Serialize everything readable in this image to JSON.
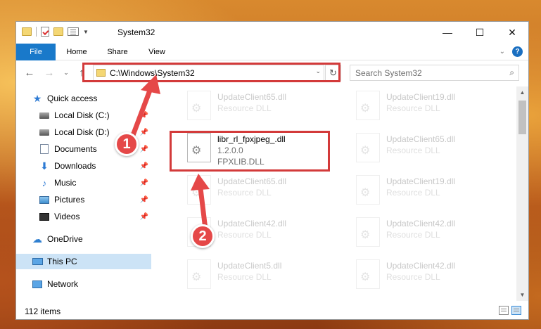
{
  "window": {
    "title": "System32",
    "controls": {
      "minimize": "—",
      "maximize": "☐",
      "close": "✕"
    }
  },
  "ribbon": {
    "tabs": [
      "File",
      "Home",
      "Share",
      "View"
    ],
    "expand_glyph": "⌄",
    "help_glyph": "?"
  },
  "nav": {
    "back_glyph": "←",
    "forward_glyph": "→",
    "recent_glyph": "⌄",
    "up_glyph": "↑"
  },
  "address": {
    "path": "C:\\Windows\\System32",
    "refresh_glyph": "↻",
    "dropdown_glyph": "⌄"
  },
  "search": {
    "placeholder": "Search System32",
    "icon_glyph": "⌕"
  },
  "sidebar": {
    "items": [
      {
        "label": "Quick access",
        "icon": "quick-access-icon"
      },
      {
        "label": "Local Disk (C:)",
        "icon": "disk-icon",
        "pinned": true
      },
      {
        "label": "Local Disk (D:)",
        "icon": "disk-icon",
        "pinned": true
      },
      {
        "label": "Documents",
        "icon": "documents-icon",
        "pinned": true
      },
      {
        "label": "Downloads",
        "icon": "downloads-icon",
        "pinned": true
      },
      {
        "label": "Music",
        "icon": "music-icon",
        "pinned": true
      },
      {
        "label": "Pictures",
        "icon": "pictures-icon",
        "pinned": true
      },
      {
        "label": "Videos",
        "icon": "videos-icon",
        "pinned": true
      },
      {
        "label": "OneDrive",
        "icon": "onedrive-icon"
      },
      {
        "label": "This PC",
        "icon": "this-pc-icon",
        "selected": true
      },
      {
        "label": "Network",
        "icon": "network-icon"
      }
    ],
    "pin_glyph": "📌"
  },
  "files": [
    {
      "name": "UpdateClient65.dll",
      "line1": "Resource DLL",
      "line2": ""
    },
    {
      "name": "UpdateClient19.dll",
      "line1": "Resource DLL",
      "line2": ""
    },
    {
      "name": "libr_rl_fpxjpeg_.dll",
      "line1": "1.2.0.0",
      "line2": "FPXLIB.DLL"
    },
    {
      "name": "UpdateClient65.dll",
      "line1": "Resource DLL",
      "line2": ""
    },
    {
      "name": "UpdateClient65.dll",
      "line1": "Resource DLL",
      "line2": ""
    },
    {
      "name": "UpdateClient19.dll",
      "line1": "Resource DLL",
      "line2": ""
    },
    {
      "name": "UpdateClient42.dll",
      "line1": "Resource DLL",
      "line2": ""
    },
    {
      "name": "UpdateClient42.dll",
      "line1": "Resource DLL",
      "line2": ""
    },
    {
      "name": "UpdateClient5.dll",
      "line1": "Resource DLL",
      "line2": ""
    },
    {
      "name": "UpdateClient42.dll",
      "line1": "Resource DLL",
      "line2": ""
    }
  ],
  "status": {
    "item_count": "112 items"
  },
  "annotations": {
    "callout_1": "1",
    "callout_2": "2",
    "color": "#e54848"
  },
  "colors": {
    "file_tab": "#1979ca",
    "selection": "#cce3f6",
    "highlight_border": "#d33a3a"
  }
}
